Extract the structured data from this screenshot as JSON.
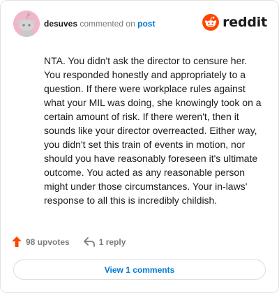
{
  "comment": {
    "username": "desuves",
    "action": "commented on",
    "target": "post",
    "body": "NTA. You didn't ask the director to censure her. You responded honestly and appropriately to a question. If there were workplace rules against what your MIL was doing, she knowingly took on a certain amount of risk. If there weren't, then it sounds like your director overreacted. Either way, you didn't set this train of events in motion, nor should you have reasonably foreseen it's ultimate outcome. You acted as any reasonable person might under those circumstances. Your in-laws' response to all this is incredibly childish."
  },
  "brand": {
    "name": "reddit",
    "icon": "reddit-logo-icon",
    "color": "#ff4500"
  },
  "footer": {
    "upvotes": "98 upvotes",
    "upvote_icon": "upvote-arrow-icon",
    "upvote_color": "#ff4500",
    "replies": "1 reply",
    "reply_icon": "reply-arrow-icon"
  },
  "view_button": {
    "label": "View 1 comments"
  },
  "colors": {
    "link": "#0079d3",
    "text": "#1c1c1c",
    "muted": "#7c7c7c",
    "avatar_bg": "#f0b7c8"
  }
}
